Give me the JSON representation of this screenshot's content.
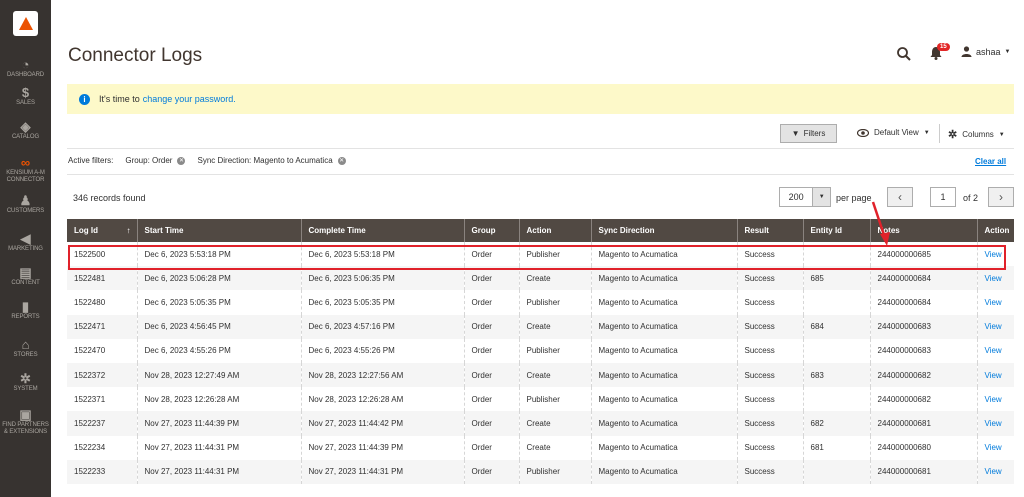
{
  "sidebar": {
    "items": [
      {
        "icon": "dashboard-icon",
        "glyph": "◔",
        "label": "DASHBOARD"
      },
      {
        "icon": "sales-icon",
        "glyph": "$",
        "label": "SALES"
      },
      {
        "icon": "catalog-icon",
        "glyph": "◈",
        "label": "CATALOG"
      },
      {
        "icon": "connector-icon",
        "glyph": "∞",
        "label": "KENSIUM A-M CONNECTOR"
      },
      {
        "icon": "customers-icon",
        "glyph": "♟",
        "label": "CUSTOMERS"
      },
      {
        "icon": "marketing-icon",
        "glyph": "◀",
        "label": "MARKETING"
      },
      {
        "icon": "content-icon",
        "glyph": "▤",
        "label": "CONTENT"
      },
      {
        "icon": "reports-icon",
        "glyph": "▮",
        "label": "REPORTS"
      },
      {
        "icon": "stores-icon",
        "glyph": "⌂",
        "label": "STORES"
      },
      {
        "icon": "system-icon",
        "glyph": "✲",
        "label": "SYSTEM"
      },
      {
        "icon": "partners-icon",
        "glyph": "▣",
        "label": "FIND PARTNERS & EXTENSIONS"
      }
    ]
  },
  "header": {
    "title": "Connector Logs",
    "notifications_count": "15",
    "user": "ashaa"
  },
  "message": {
    "text": "It's time to",
    "link": "change your password."
  },
  "toolbar": {
    "filters_label": "Filters",
    "view_label": "Default View",
    "columns_label": "Columns"
  },
  "active_filters": {
    "label": "Active filters:",
    "chips": [
      "Group: Order",
      "Sync Direction: Magento to Acumatica"
    ],
    "clear_label": "Clear all"
  },
  "pagination": {
    "records": "346 records found",
    "per_page_value": "200",
    "per_page_label": "per page",
    "page": "1",
    "of": "of 2"
  },
  "grid": {
    "columns": [
      "Log Id",
      "Start Time",
      "Complete Time",
      "Group",
      "Action",
      "Sync Direction",
      "Result",
      "Entity Id",
      "Notes",
      "Action"
    ],
    "rows": [
      [
        "1522500",
        "Dec 6, 2023 5:53:18 PM",
        "Dec 6, 2023 5:53:18 PM",
        "Order",
        "Publisher",
        "Magento to Acumatica",
        "Success",
        "",
        "244000000685",
        "View"
      ],
      [
        "1522481",
        "Dec 6, 2023 5:06:28 PM",
        "Dec 6, 2023 5:06:35 PM",
        "Order",
        "Create",
        "Magento to Acumatica",
        "Success",
        "685",
        "244000000684",
        "View"
      ],
      [
        "1522480",
        "Dec 6, 2023 5:05:35 PM",
        "Dec 6, 2023 5:05:35 PM",
        "Order",
        "Publisher",
        "Magento to Acumatica",
        "Success",
        "",
        "244000000684",
        "View"
      ],
      [
        "1522471",
        "Dec 6, 2023 4:56:45 PM",
        "Dec 6, 2023 4:57:16 PM",
        "Order",
        "Create",
        "Magento to Acumatica",
        "Success",
        "684",
        "244000000683",
        "View"
      ],
      [
        "1522470",
        "Dec 6, 2023 4:55:26 PM",
        "Dec 6, 2023 4:55:26 PM",
        "Order",
        "Publisher",
        "Magento to Acumatica",
        "Success",
        "",
        "244000000683",
        "View"
      ],
      [
        "1522372",
        "Nov 28, 2023 12:27:49 AM",
        "Nov 28, 2023 12:27:56 AM",
        "Order",
        "Create",
        "Magento to Acumatica",
        "Success",
        "683",
        "244000000682",
        "View"
      ],
      [
        "1522371",
        "Nov 28, 2023 12:26:28 AM",
        "Nov 28, 2023 12:26:28 AM",
        "Order",
        "Publisher",
        "Magento to Acumatica",
        "Success",
        "",
        "244000000682",
        "View"
      ],
      [
        "1522237",
        "Nov 27, 2023 11:44:39 PM",
        "Nov 27, 2023 11:44:42 PM",
        "Order",
        "Create",
        "Magento to Acumatica",
        "Success",
        "682",
        "244000000681",
        "View"
      ],
      [
        "1522234",
        "Nov 27, 2023 11:44:31 PM",
        "Nov 27, 2023 11:44:39 PM",
        "Order",
        "Create",
        "Magento to Acumatica",
        "Success",
        "681",
        "244000000680",
        "View"
      ],
      [
        "1522233",
        "Nov 27, 2023 11:44:31 PM",
        "Nov 27, 2023 11:44:31 PM",
        "Order",
        "Publisher",
        "Magento to Acumatica",
        "Success",
        "",
        "244000000681",
        "View"
      ]
    ]
  },
  "colors": {
    "accent": "#eb5202",
    "header_bg": "#514943",
    "highlight": "#e0212a",
    "link": "#007bdb"
  }
}
